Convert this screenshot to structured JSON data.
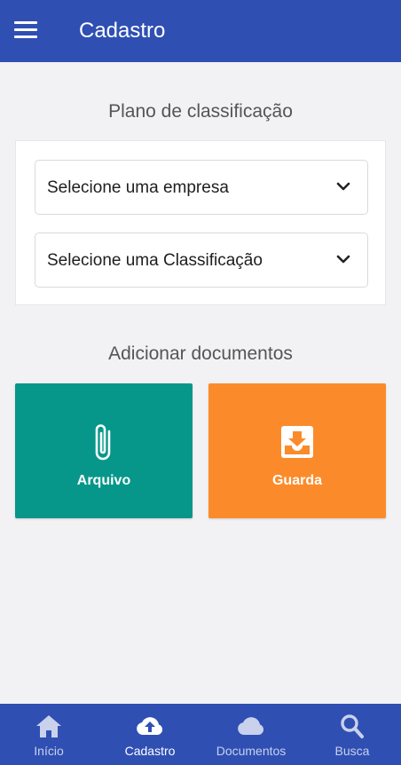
{
  "appbar": {
    "title": "Cadastro",
    "menu_icon": "menu-icon"
  },
  "classification": {
    "title": "Plano de classificação",
    "company_select": {
      "value": "Selecione uma empresa",
      "icon": "chevron-down-icon"
    },
    "class_select": {
      "value": "Selecione uma Classificação",
      "icon": "chevron-down-icon"
    }
  },
  "add_documents": {
    "title": "Adicionar documentos",
    "tiles": [
      {
        "label": "Arquivo",
        "icon": "paperclip-icon",
        "color": "#07978a"
      },
      {
        "label": "Guarda",
        "icon": "inbox-download-icon",
        "color": "#fb8b2a"
      }
    ]
  },
  "bottom_nav": {
    "items": [
      {
        "label": "Início",
        "icon": "home-icon",
        "active": false
      },
      {
        "label": "Cadastro",
        "icon": "cloud-upload-icon",
        "active": true
      },
      {
        "label": "Documentos",
        "icon": "cloud-icon",
        "active": false
      },
      {
        "label": "Busca",
        "icon": "search-icon",
        "active": false
      }
    ]
  },
  "colors": {
    "primary": "#2f4fb3",
    "background": "#f2f2f4"
  }
}
